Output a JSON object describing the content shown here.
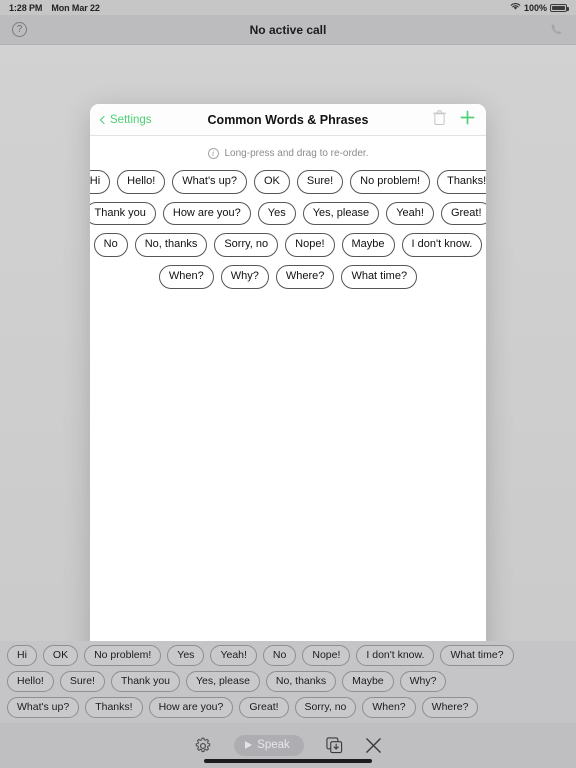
{
  "status_bar": {
    "time": "1:28 PM",
    "date": "Mon Mar 22",
    "wifi_icon": "wifi-icon",
    "battery_percent": "100%",
    "battery_icon": "battery-full-icon"
  },
  "top_bar": {
    "help_icon": "help-circle-icon",
    "title": "No active call",
    "phone_icon": "phone-icon"
  },
  "modal": {
    "back_label": "Settings",
    "title": "Common Words & Phrases",
    "trash_icon": "trash-icon",
    "add_icon": "plus-icon",
    "hint_icon": "info-circle-icon",
    "hint": "Long-press and drag to re-order.",
    "rows": [
      [
        "Hi",
        "Hello!",
        "What's up?",
        "OK",
        "Sure!",
        "No problem!",
        "Thanks!"
      ],
      [
        "Thank you",
        "How are you?",
        "Yes",
        "Yes, please",
        "Yeah!",
        "Great!"
      ],
      [
        "No",
        "No, thanks",
        "Sorry, no",
        "Nope!",
        "Maybe",
        "I don't know."
      ],
      [
        "When?",
        "Why?",
        "Where?",
        "What time?"
      ]
    ]
  },
  "bottom_bar": {
    "rows": [
      [
        "Hi",
        "OK",
        "No problem!",
        "Yes",
        "Yeah!",
        "No",
        "Nope!",
        "I don't know.",
        "What time?"
      ],
      [
        "Hello!",
        "Sure!",
        "Thank you",
        "Yes, please",
        "No, thanks",
        "Maybe",
        "Why?"
      ],
      [
        "What's up?",
        "Thanks!",
        "How are you?",
        "Great!",
        "Sorry, no",
        "When?",
        "Where?"
      ]
    ]
  },
  "toolbar": {
    "settings_icon": "gear-icon",
    "speak_label": "Speak",
    "speak_icon": "play-icon",
    "save_icon": "save-icon",
    "close_icon": "close-x-icon"
  },
  "colors": {
    "accent_green": "#4cd073",
    "background": "#cfcfcf",
    "modal_background": "#ffffff",
    "pill_border": "#55555a",
    "bottom_bar": "#c5c5c7",
    "toolbar": "#bfbfc1"
  }
}
